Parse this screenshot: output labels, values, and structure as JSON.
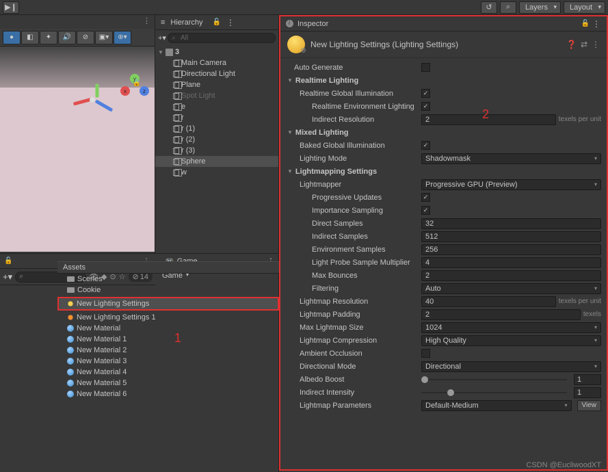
{
  "topbar": {
    "layers": "Layers",
    "layout": "Layout"
  },
  "hierarchy": {
    "title": "Hierarchy",
    "search_ph": "All",
    "scene": "3",
    "items": [
      {
        "name": "Main Camera"
      },
      {
        "name": "Directional Light"
      },
      {
        "name": "Plane"
      },
      {
        "name": "Spot Light",
        "disabled": true
      },
      {
        "name": "e"
      },
      {
        "name": "r"
      },
      {
        "name": "r (1)"
      },
      {
        "name": "r (2)"
      },
      {
        "name": "r (3)"
      },
      {
        "name": "Sphere",
        "sel": true
      },
      {
        "name": "w"
      }
    ]
  },
  "game": {
    "tab": "Game",
    "mode": "Game"
  },
  "project": {
    "star_count": "14"
  },
  "assets": {
    "header": "Assets",
    "items": [
      {
        "label": "Scenes",
        "type": "folder"
      },
      {
        "label": "Cookie",
        "type": "folder"
      },
      {
        "label": "New Lighting Settings",
        "type": "light",
        "sel": true,
        "hl": true
      },
      {
        "label": "New Lighting Settings 1",
        "type": "light2"
      },
      {
        "label": "New Material",
        "type": "mat"
      },
      {
        "label": "New Material 1",
        "type": "mat"
      },
      {
        "label": "New Material 2",
        "type": "mat"
      },
      {
        "label": "New Material 3",
        "type": "mat"
      },
      {
        "label": "New Material 4",
        "type": "mat"
      },
      {
        "label": "New Material 5",
        "type": "mat"
      },
      {
        "label": "New Material 6",
        "type": "mat"
      }
    ]
  },
  "annotations": {
    "one": "1",
    "two": "2"
  },
  "inspector": {
    "tab": "Inspector",
    "title": "New Lighting Settings (Lighting Settings)",
    "auto_generate": {
      "label": "Auto Generate",
      "checked": false
    },
    "sections": {
      "realtime": {
        "title": "Realtime Lighting",
        "rgi": {
          "label": "Realtime Global Illumination",
          "checked": true
        },
        "rel": {
          "label": "Realtime Environment Lighting",
          "checked": true
        },
        "ires": {
          "label": "Indirect Resolution",
          "value": "2",
          "unit": "texels per unit"
        }
      },
      "mixed": {
        "title": "Mixed Lighting",
        "bgi": {
          "label": "Baked Global Illumination",
          "checked": true
        },
        "mode": {
          "label": "Lighting Mode",
          "value": "Shadowmask"
        }
      },
      "lm": {
        "title": "Lightmapping Settings",
        "mapper": {
          "label": "Lightmapper",
          "value": "Progressive GPU (Preview)"
        },
        "pu": {
          "label": "Progressive Updates",
          "checked": true
        },
        "is": {
          "label": "Importance Sampling",
          "checked": true
        },
        "ds": {
          "label": "Direct Samples",
          "value": "32"
        },
        "inds": {
          "label": "Indirect Samples",
          "value": "512"
        },
        "es": {
          "label": "Environment Samples",
          "value": "256"
        },
        "lps": {
          "label": "Light Probe Sample Multiplier",
          "value": "4"
        },
        "mb": {
          "label": "Max Bounces",
          "value": "2"
        },
        "filt": {
          "label": "Filtering",
          "value": "Auto"
        },
        "lres": {
          "label": "Lightmap Resolution",
          "value": "40",
          "unit": "texels per unit"
        },
        "lpad": {
          "label": "Lightmap Padding",
          "value": "2",
          "unit": "texels"
        },
        "lmax": {
          "label": "Max Lightmap Size",
          "value": "1024"
        },
        "lcomp": {
          "label": "Lightmap Compression",
          "value": "High Quality"
        },
        "ao": {
          "label": "Ambient Occlusion",
          "checked": false
        },
        "dm": {
          "label": "Directional Mode",
          "value": "Directional"
        },
        "ab": {
          "label": "Albedo Boost",
          "value": "1",
          "pos": 0
        },
        "ii": {
          "label": "Indirect Intensity",
          "value": "1",
          "pos": 18
        },
        "lp": {
          "label": "Lightmap Parameters",
          "value": "Default-Medium",
          "btn": "View"
        }
      }
    }
  },
  "watermark": "CSDN @EucliwoodXT"
}
